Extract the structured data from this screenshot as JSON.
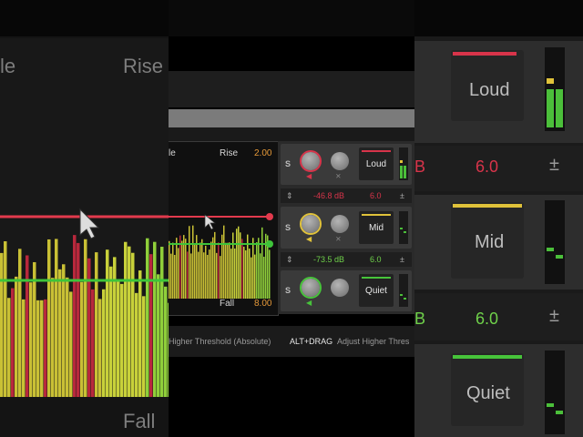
{
  "left_zoom": {
    "rise_label": "Rise",
    "fall_label": "Fall",
    "partial_label": "le"
  },
  "right_zoom": {
    "loud_label": "Loud",
    "mid_label": "Mid",
    "quiet_label": "Quiet",
    "loud_value": "6.0",
    "mid_value": "6.0",
    "loud_db_partial": "B",
    "quiet_db_partial": "B",
    "plusminus": "±"
  },
  "graph": {
    "partial_label": "le",
    "rise_label": "Rise",
    "rise_value": "2.00",
    "fall_label": "Fall",
    "fall_value": "8.00"
  },
  "bands": [
    {
      "s_label": "S",
      "name": "Loud",
      "color": "#d8344a"
    },
    {
      "s_label": "S",
      "name": "Mid",
      "color": "#e0c23a"
    },
    {
      "s_label": "S",
      "name": "Quiet",
      "color": "#47c43a"
    }
  ],
  "readouts": [
    {
      "threshold": "-46.8 dB",
      "ratio": "6.0",
      "color": "#d8344a",
      "plusminus": "±"
    },
    {
      "threshold": "-73.5 dB",
      "ratio": "6.0",
      "color": "#6fd14a",
      "plusminus": "±"
    }
  ],
  "status": {
    "hint_text": "Higher Threshold (Absolute)",
    "shortcut": "ALT+DRAG",
    "hint_text2": "Adjust Higher Thres"
  },
  "colors": {
    "loud": "#d8344a",
    "mid": "#e0c23a",
    "quiet": "#47c43a",
    "value_orange": "#e79a39"
  },
  "icons": [
    "speaker-icon",
    "cursor-icon",
    "threshold-handle-icon"
  ]
}
